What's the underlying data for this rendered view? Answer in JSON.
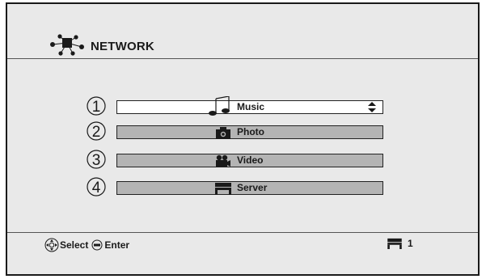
{
  "header": {
    "title": "NETWORK",
    "icon": "network-icon"
  },
  "menu": {
    "items": [
      {
        "number": "1",
        "label": "Music",
        "icon": "music-note-icon",
        "selected": true
      },
      {
        "number": "2",
        "label": "Photo",
        "icon": "camera-icon",
        "selected": false
      },
      {
        "number": "3",
        "label": "Video",
        "icon": "video-camera-icon",
        "selected": false
      },
      {
        "number": "4",
        "label": "Server",
        "icon": "server-icon",
        "selected": false
      }
    ]
  },
  "footer": {
    "select_label": "Select",
    "enter_label": "Enter",
    "server_count": "1"
  },
  "colors": {
    "background": "#e9e9e9",
    "item_unselected": "#b4b4b4",
    "item_selected": "#ffffff",
    "border": "#1a1a1a"
  }
}
